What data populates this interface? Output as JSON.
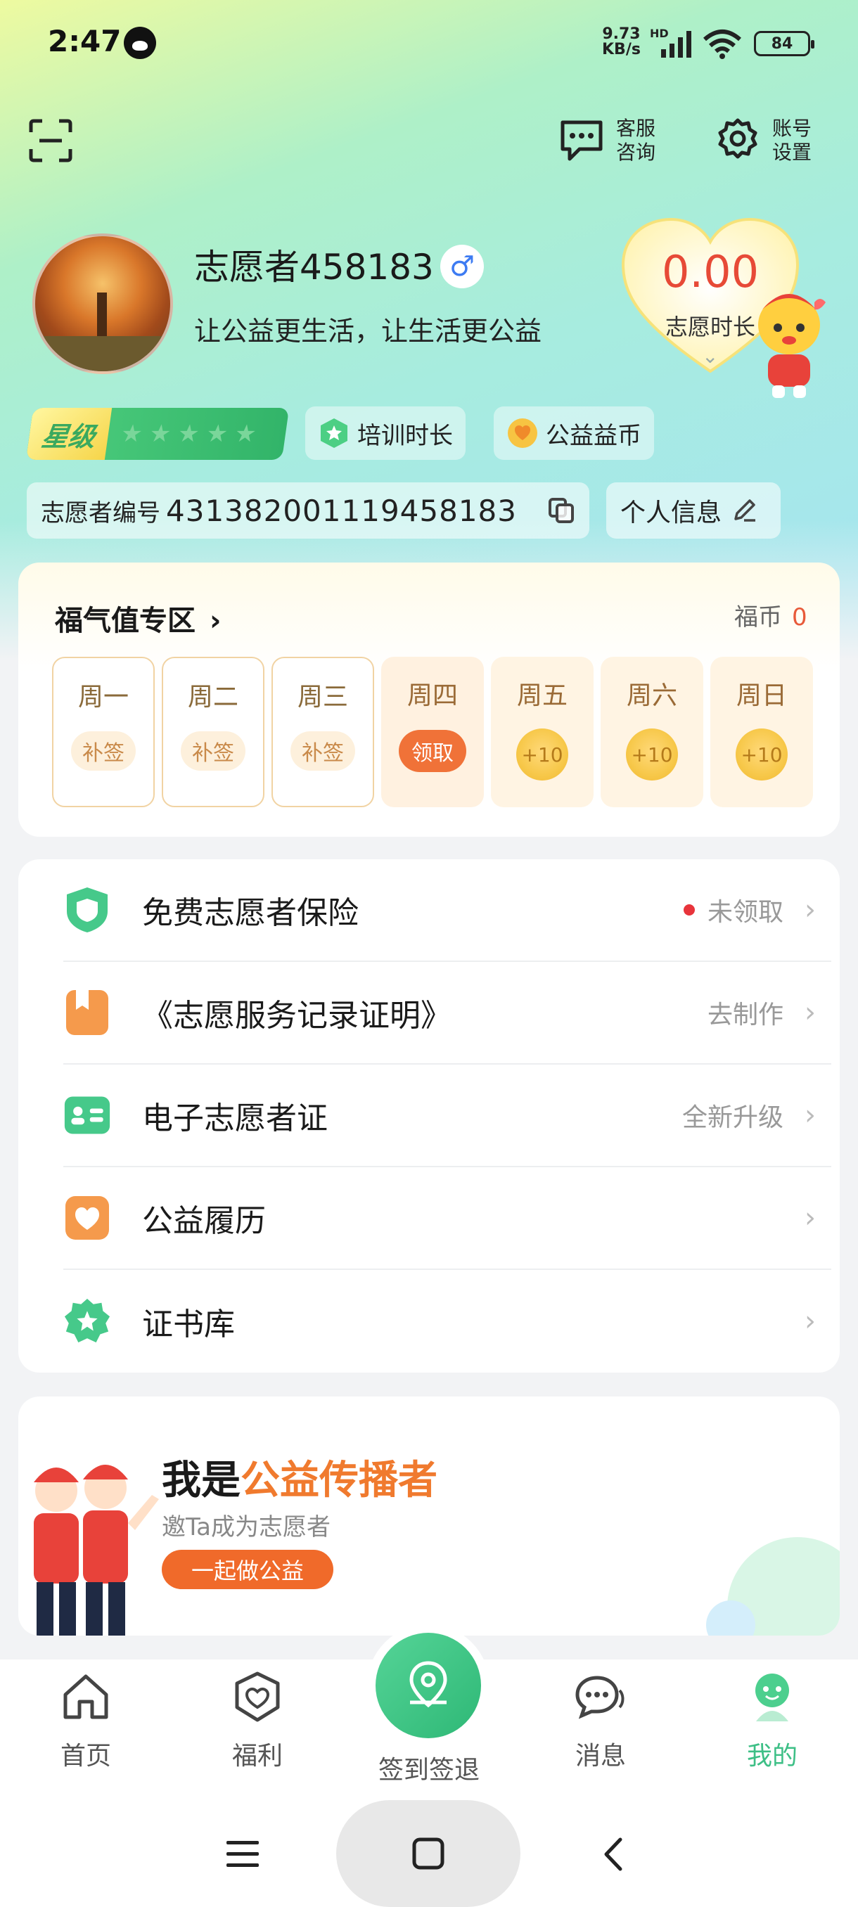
{
  "status_bar": {
    "time": "2:47",
    "net_speed_value": "9.73",
    "net_speed_unit": "KB/s",
    "network_type": "HD",
    "battery": "84"
  },
  "header": {
    "service_label_1": "客服",
    "service_label_2": "咨询",
    "settings_label_1": "账号",
    "settings_label_2": "设置"
  },
  "profile": {
    "username": "志愿者458183",
    "gender_symbol": "♂",
    "motto": "让公益更生活，让生活更公益",
    "volunteer_hours": "0.00",
    "volunteer_hours_label": "志愿时长",
    "star_level_label": "星级",
    "star_count": 5,
    "stars_filled": 0,
    "training_label": "培训时长",
    "coins_label": "公益益币",
    "volunteer_id_label": "志愿者编号",
    "volunteer_id": "431382001119458183",
    "personal_info_label": "个人信息"
  },
  "fuqi": {
    "title": "福气值专区",
    "coin_label": "福币",
    "coin_value": "0",
    "days": [
      {
        "name": "周一",
        "action": "补签",
        "state": "past"
      },
      {
        "name": "周二",
        "action": "补签",
        "state": "past"
      },
      {
        "name": "周三",
        "action": "补签",
        "state": "past"
      },
      {
        "name": "周四",
        "action": "领取",
        "state": "today"
      },
      {
        "name": "周五",
        "action": "+10",
        "state": "future"
      },
      {
        "name": "周六",
        "action": "+10",
        "state": "future"
      },
      {
        "name": "周日",
        "action": "+10",
        "state": "future"
      }
    ]
  },
  "menu": {
    "items": [
      {
        "label": "免费志愿者保险",
        "value": "未领取",
        "icon": "shield-icon"
      },
      {
        "label": "《志愿服务记录证明》",
        "value": "去制作",
        "icon": "certificate-icon"
      },
      {
        "label": "电子志愿者证",
        "value": "全新升级",
        "icon": "id-card-icon"
      },
      {
        "label": "公益履历",
        "value": "",
        "icon": "heart-icon"
      },
      {
        "label": "证书库",
        "value": "",
        "icon": "star-badge-icon"
      }
    ]
  },
  "banner": {
    "title_prefix": "我是",
    "title_highlight": "公益传播者",
    "subtitle": "邀Ta成为志愿者",
    "button": "一起做公益"
  },
  "tabbar": {
    "tabs": [
      {
        "label": "首页",
        "icon": "home-icon"
      },
      {
        "label": "福利",
        "icon": "welfare-heart-icon"
      },
      {
        "label": "签到签退",
        "icon": "location-pin-icon"
      },
      {
        "label": "消息",
        "icon": "chat-icon"
      },
      {
        "label": "我的",
        "icon": "profile-icon"
      }
    ],
    "active_index": 4,
    "active_color": "#3dbf86"
  },
  "colors": {
    "accent_green": "#3dbf86",
    "accent_orange": "#f07238",
    "hours_red": "#e74a37"
  }
}
